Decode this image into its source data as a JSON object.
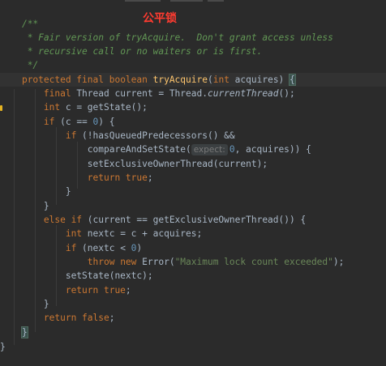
{
  "annotation": "公平锁",
  "code": {
    "comment": [
      "/**",
      " * Fair version of tryAcquire.  Don't grant access unless",
      " * recursive call or no waiters or is first.",
      " */"
    ],
    "sig_kw": "protected final boolean ",
    "sig_fn": "tryAcquire",
    "sig_open": "(",
    "sig_param_type": "int",
    "sig_param": " acquires) ",
    "sig_brace": "{",
    "l_final_kw": "final ",
    "l_final_rest": "Thread current = Thread.",
    "l_final_it": "currentThread",
    "l_final_end": "();",
    "l_int_kw": "int ",
    "l_int_rest": "c = getState();",
    "l_if_kw": "if ",
    "l_if_open": "(c == ",
    "l_if_num": "0",
    "l_if_close": ") {",
    "l_if2_kw": "if ",
    "l_if2_rest": "(!hasQueuedPredecessors() &&",
    "l_cas_a": "compareAndSetState(",
    "l_cas_hint": "expect:",
    "l_cas_num": "0",
    "l_cas_b": ", acquires)) {",
    "l_set": "setExclusiveOwnerThread(current);",
    "l_ret_kw": "return true",
    "l_ret_semi": ";",
    "l_close_inner": "}",
    "l_close_if": "}",
    "l_else_kw": "else if ",
    "l_else_rest": "(current == getExclusiveOwnerThread()) {",
    "l_nextc_kw": "int ",
    "l_nextc_rest": "nextc = c + acquires;",
    "l_if3_kw": "if ",
    "l_if3_open": "(nextc < ",
    "l_if3_num": "0",
    "l_if3_close": ")",
    "l_throw_kw": "throw new ",
    "l_throw_cls": "Error(",
    "l_throw_str": "\"Maximum lock count exceeded\"",
    "l_throw_end": ");",
    "l_setstate": "setState(nextc);",
    "l_ret2_kw": "return true",
    "l_ret2_semi": ";",
    "l_close_else": "}",
    "l_retf_kw": "return false",
    "l_retf_semi": ";",
    "l_close_method_inner": "}",
    "l_close_method": "}"
  },
  "colors": {
    "background": "#2b2b2b",
    "current_line": "#323232",
    "keyword": "#cc7832",
    "function": "#ffc66d",
    "number": "#6897bb",
    "string": "#6a8759",
    "comment": "#629755",
    "annotation": "#ff3b30",
    "gutter_warning": "#e6b422"
  }
}
